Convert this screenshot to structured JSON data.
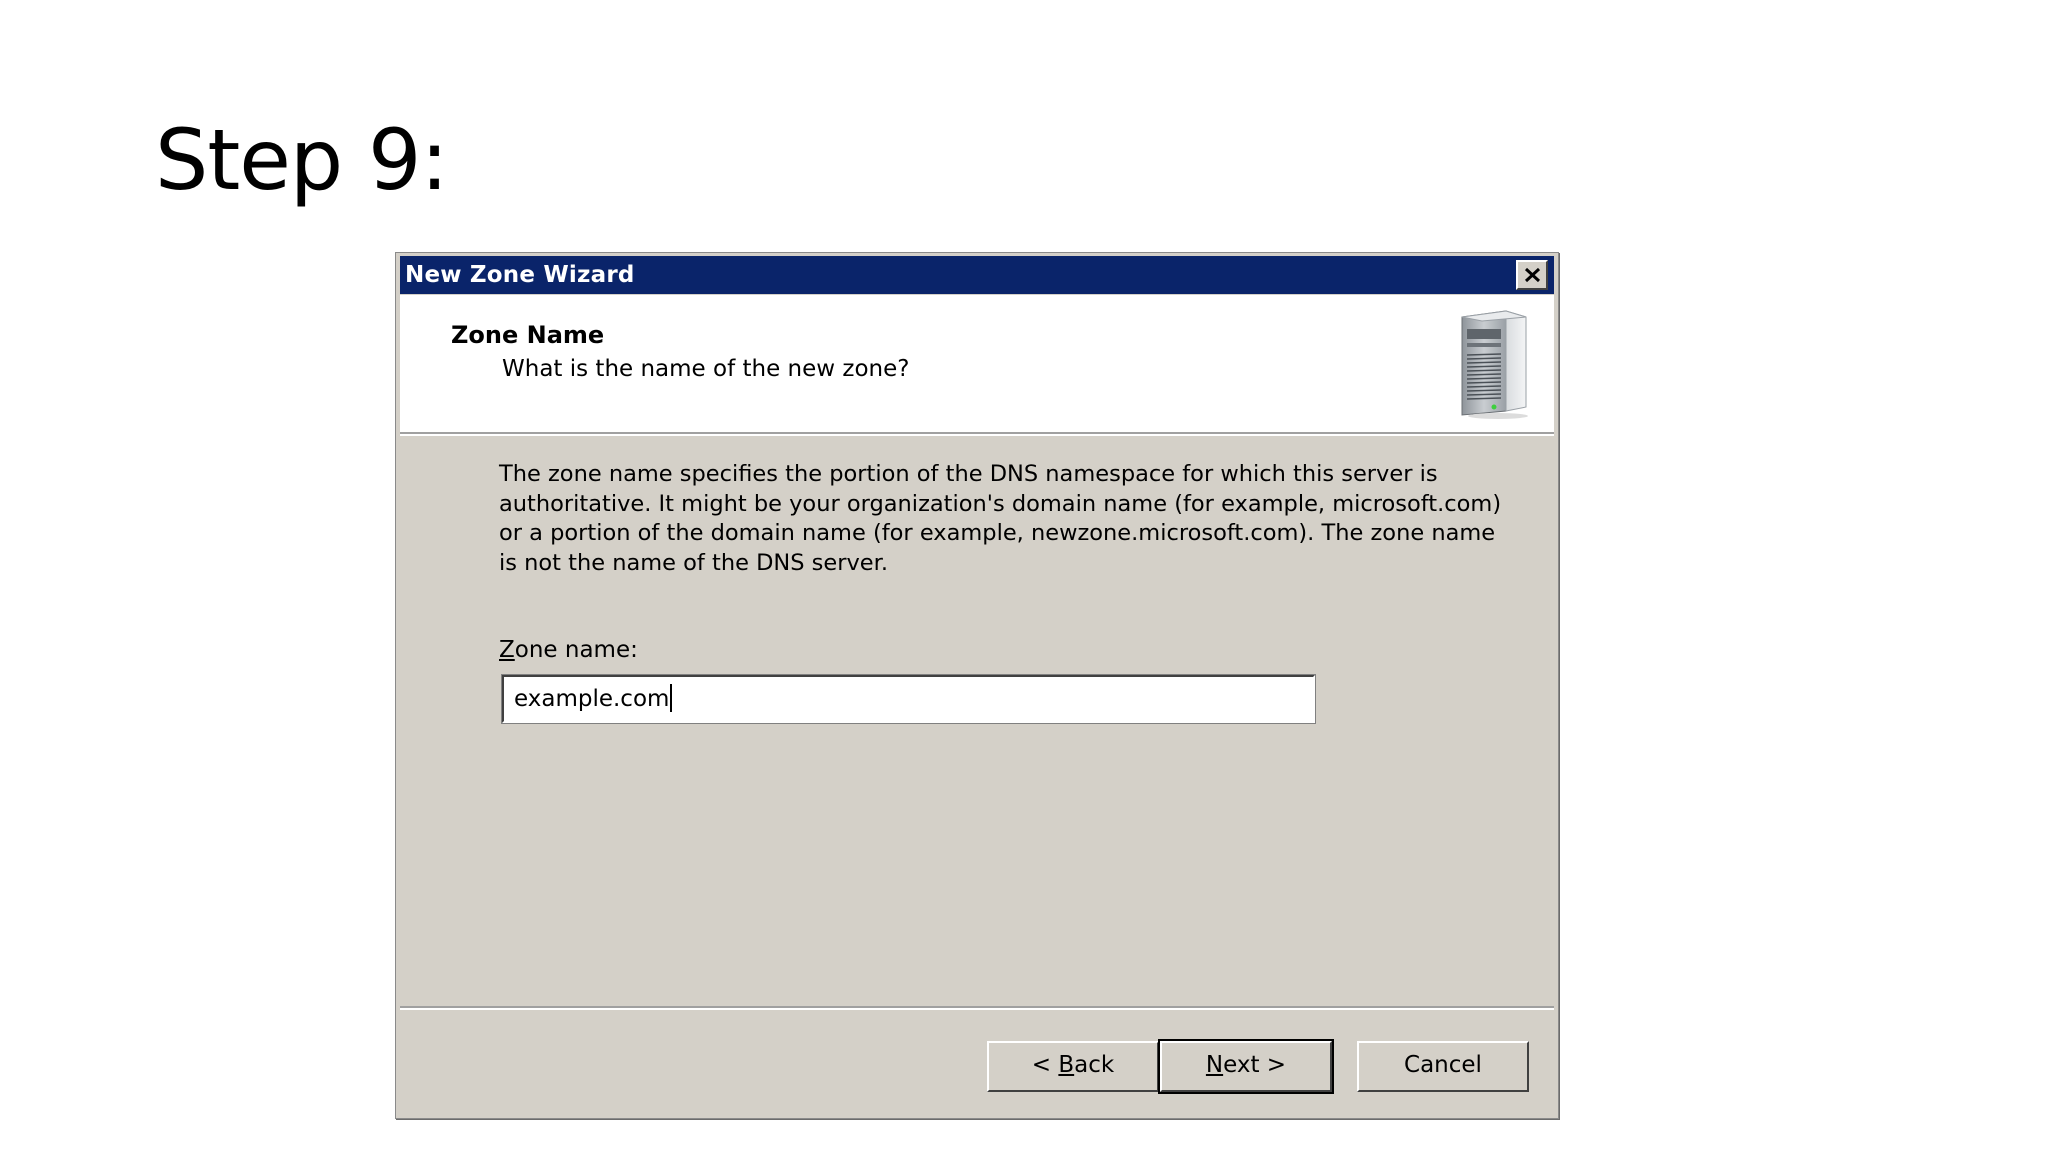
{
  "slide": {
    "title": "Step 9:"
  },
  "window": {
    "title": "New Zone Wizard"
  },
  "header": {
    "title": "Zone Name",
    "subtitle": "What is the name of the new zone?",
    "icon": "server-icon"
  },
  "body": {
    "description": "The zone name specifies the portion of the DNS namespace for which this server is authoritative. It might be your organization's domain name (for example,  microsoft.com) or a portion of the domain name (for example, newzone.microsoft.com). The zone name is not the name of the DNS server.",
    "zone_label_accel": "Z",
    "zone_label_rest": "one name:",
    "zone_value": "example.com"
  },
  "buttons": {
    "back_prefix": "< ",
    "back_accel": "B",
    "back_rest": "ack",
    "next_accel": "N",
    "next_rest": "ext >",
    "cancel": "Cancel"
  },
  "colors": {
    "titlebar": "#0a246a",
    "dialog_face": "#d4d0c8"
  }
}
